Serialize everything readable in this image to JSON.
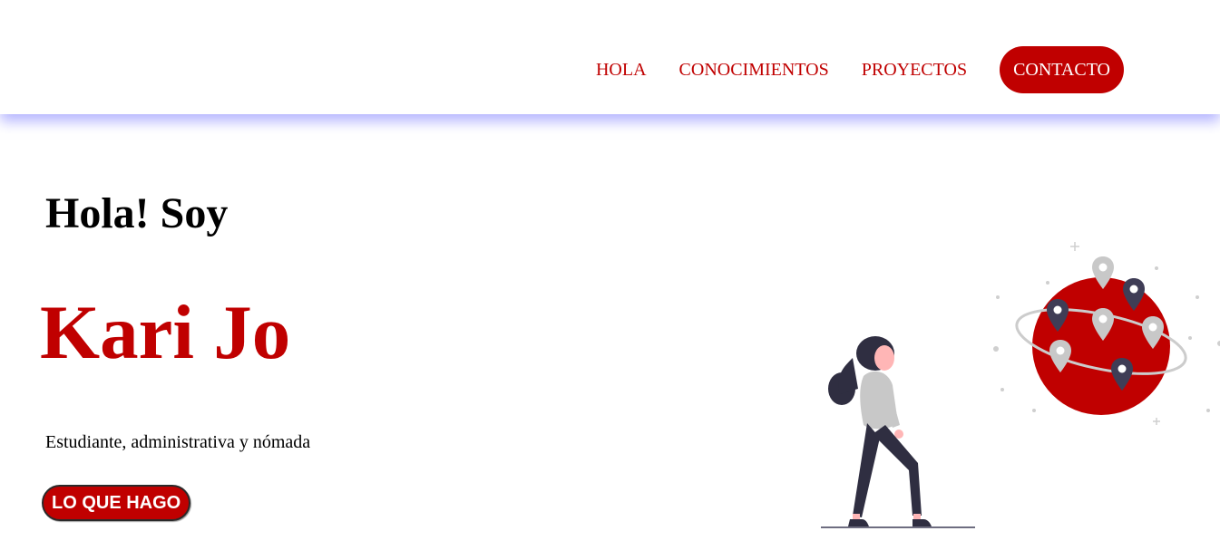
{
  "nav": {
    "items": [
      {
        "label": "HOLA"
      },
      {
        "label": "CONOCIMIENTOS"
      },
      {
        "label": "PROYECTOS"
      }
    ],
    "contact_label": "CONTACTO"
  },
  "hero": {
    "greeting": "Hola! Soy",
    "name": "Kari Jo",
    "subtitle": "Estudiante, administrativa y nómada",
    "cta_label": "LO QUE HAGO"
  },
  "colors": {
    "accent": "#c00000",
    "header_shadow": "#8080ff",
    "figure_dark": "#2f2e41",
    "pin_light": "#c8c8c8"
  },
  "illustration": {
    "icons": [
      "woman-walking-icon",
      "globe-icon",
      "location-pin-icon"
    ]
  }
}
